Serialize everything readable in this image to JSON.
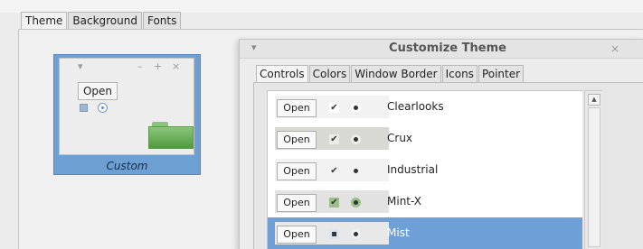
{
  "main_tabs": [
    "Theme",
    "Background",
    "Fonts"
  ],
  "theme_preview": {
    "title_icons": [
      "▾",
      "–",
      "+",
      "×"
    ],
    "open_label": "Open",
    "name": "Custom"
  },
  "dialog": {
    "title": "Customize Theme",
    "menu_icon": "▾",
    "close_icon": "×",
    "tabs": [
      "Controls",
      "Colors",
      "Window Border",
      "Icons",
      "Pointer"
    ],
    "scroll_up_icon": "▲",
    "themes": [
      {
        "name": "Clearlooks",
        "open_label": "Open",
        "check_glyph": "✔",
        "chip_bg": "#f2f2f2",
        "check_bg": "#ffffff",
        "radio_bg": "#ffffff"
      },
      {
        "name": "Crux",
        "open_label": "Open",
        "check_glyph": "✔",
        "chip_bg": "#d8d9d2",
        "check_bg": "#ecece8",
        "radio_bg": "#ecece8"
      },
      {
        "name": "Industrial",
        "open_label": "Open",
        "check_glyph": "✔",
        "chip_bg": "#f2f2f2",
        "check_bg": "#f2f2f2",
        "radio_bg": "#f2f2f2"
      },
      {
        "name": "Mint-X",
        "open_label": "Open",
        "check_glyph": "✔",
        "chip_bg": "#e2e2e2",
        "check_bg": "#9bbf88",
        "radio_bg": "#9bbf88"
      },
      {
        "name": "Mist",
        "open_label": "Open",
        "check_glyph": "▪",
        "chip_bg": "#e8e8e8",
        "check_bg": "#dde4ee",
        "radio_bg": "#eef2f8"
      }
    ],
    "selected_theme": "Mist"
  },
  "colors": {
    "selection": "#6f9fd7",
    "theme_card": "#6e9fd2",
    "folder_green": "#5aa64a"
  }
}
